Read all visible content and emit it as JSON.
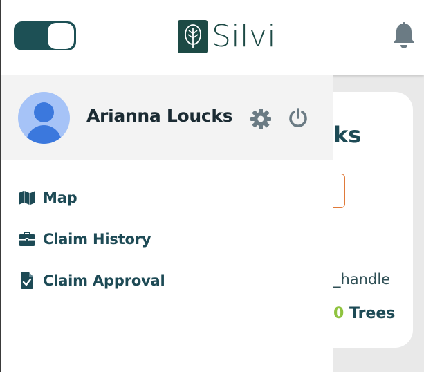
{
  "header": {
    "brand_name": "Silvi",
    "theme_toggle_state": "on"
  },
  "background": {
    "title_fragment": "ks",
    "handle_fragment": "_handle",
    "trees_count_fragment": "0",
    "trees_label": "Trees"
  },
  "drawer": {
    "user_name": "Arianna Loucks",
    "menu": [
      {
        "label": "Map",
        "icon": "map-icon"
      },
      {
        "label": "Claim History",
        "icon": "briefcase-icon"
      },
      {
        "label": "Claim Approval",
        "icon": "file-check-icon"
      }
    ]
  },
  "colors": {
    "brand": "#1d4a45",
    "toggle": "#1d5055",
    "accent_green": "#8fc33f",
    "text_dark": "#1d4a55",
    "icon_gray": "#6b7b84"
  }
}
